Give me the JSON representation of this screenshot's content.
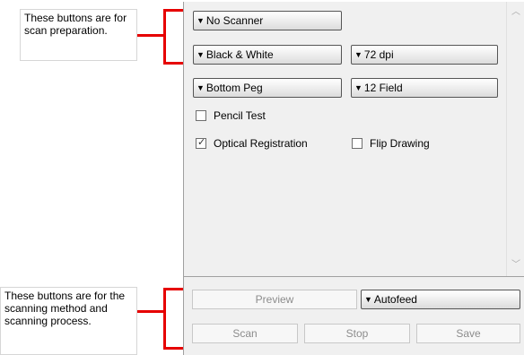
{
  "callouts": {
    "top": "These buttons are for scan preparation.",
    "bottom": "These buttons are for the scanning method and scanning process."
  },
  "scanner_dropdown": "No Scanner",
  "color_mode_dropdown": "Black & White",
  "resolution_dropdown": "72 dpi",
  "peg_dropdown": "Bottom Peg",
  "field_dropdown": "12 Field",
  "checkboxes": {
    "pencil_test": {
      "label": "Pencil Test",
      "checked": false
    },
    "optical_registration": {
      "label": "Optical Registration",
      "checked": true
    },
    "flip_drawing": {
      "label": "Flip Drawing",
      "checked": false
    }
  },
  "buttons": {
    "preview": "Preview",
    "scan": "Scan",
    "stop": "Stop",
    "save": "Save"
  },
  "feed_dropdown": "Autofeed",
  "icons": {
    "dropdown": "triangle-down",
    "checkmark": "check",
    "scroll_up": "chevron-up",
    "scroll_down": "chevron-down"
  },
  "colors": {
    "bracket": "#e60000",
    "panel": "#f0f0f0"
  }
}
